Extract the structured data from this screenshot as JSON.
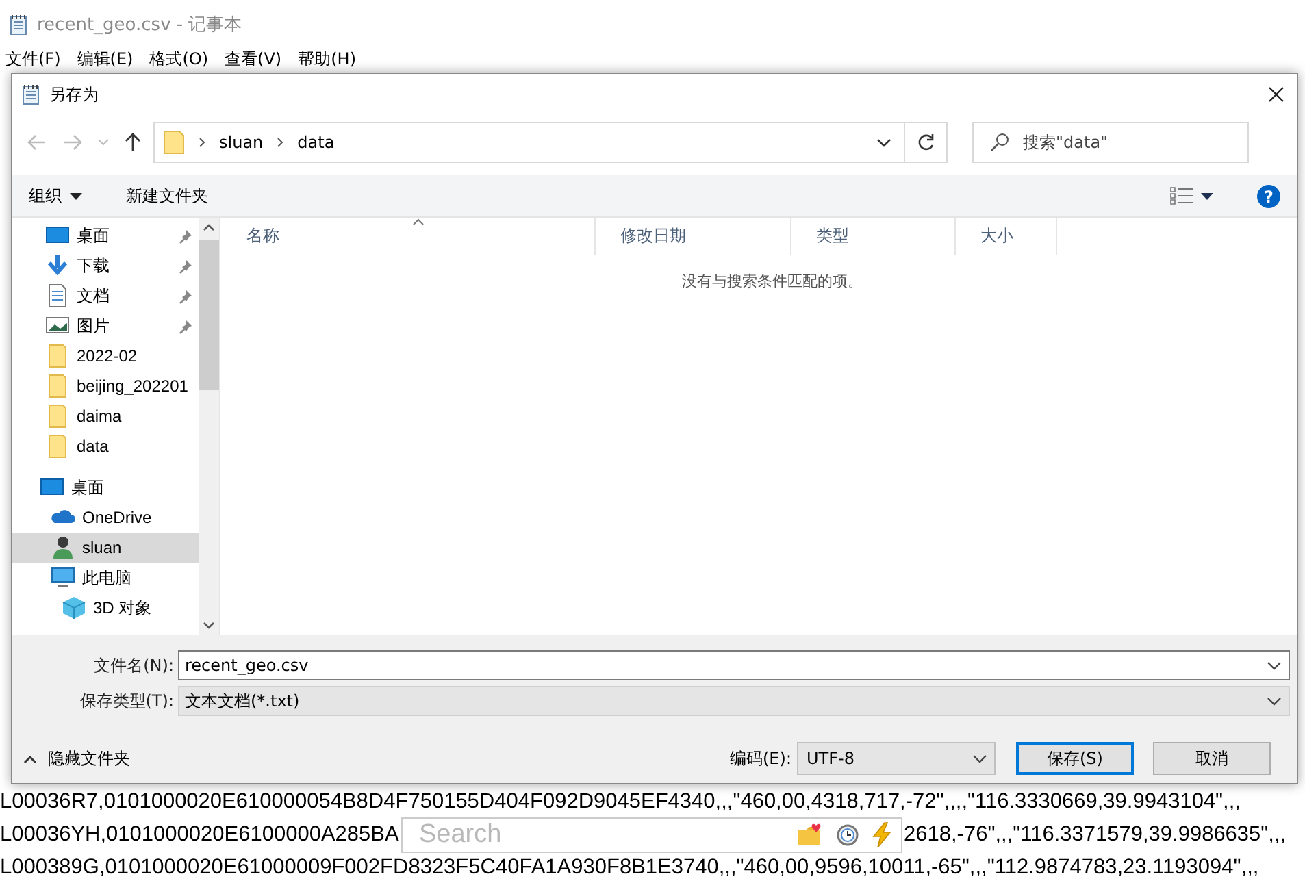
{
  "notepad": {
    "title": "recent_geo.csv - 记事本",
    "menu": [
      "文件(F)",
      "编辑(E)",
      "格式(O)",
      "查看(V)",
      "帮助(H)"
    ],
    "text_lines": [
      [
        "L00036R7,0101000020E610000054B8D4F750155D404F092D9045EF4340,,,\"460,00,4318,717,-72\",,,,\"116.3330669,39.9943104\",,,"
      ],
      [
        "L00036YH,0101000020E6100000A285BA",
        "2618,-76\",,,\"116.3371579,39.9986635\",,,"
      ],
      [
        "L000389G,0101000020E61000009F002FD8323F5C40FA1A930F8B1E3740,,,\"460,00,9596,10011,-65\",,,\"112.9874783,23.1193094\",,,"
      ]
    ]
  },
  "search_popup": {
    "placeholder": "Search"
  },
  "dialog": {
    "title": "另存为",
    "address": {
      "path": [
        "sluan",
        "data"
      ]
    },
    "search": {
      "placeholder": "搜索\"data\""
    },
    "toolbar": {
      "organize": "组织",
      "new_folder": "新建文件夹",
      "help": "?"
    },
    "navigation_pane": {
      "quick_access": [
        {
          "label": "桌面",
          "kind": "desktop",
          "pinned": true
        },
        {
          "label": "下载",
          "kind": "download",
          "pinned": true
        },
        {
          "label": "文档",
          "kind": "documents",
          "pinned": true
        },
        {
          "label": "图片",
          "kind": "pictures",
          "pinned": true
        },
        {
          "label": "2022-02",
          "kind": "folder",
          "pinned": false
        },
        {
          "label": "beijing_202201",
          "kind": "folder",
          "pinned": false
        },
        {
          "label": "daima",
          "kind": "folder",
          "pinned": false
        },
        {
          "label": "data",
          "kind": "folder",
          "pinned": false
        }
      ],
      "tree": [
        {
          "label": "桌面",
          "kind": "desktop",
          "selected": false,
          "children": [
            {
              "label": "OneDrive",
              "kind": "cloud",
              "selected": false
            },
            {
              "label": "sluan",
              "kind": "user",
              "selected": true
            },
            {
              "label": "此电脑",
              "kind": "pc",
              "selected": false,
              "children": [
                {
                  "label": "3D 对象",
                  "kind": "cube",
                  "selected": false
                }
              ]
            }
          ]
        }
      ]
    },
    "file_list": {
      "columns": [
        "名称",
        "修改日期",
        "类型",
        "大小"
      ],
      "empty_message": "没有与搜索条件匹配的项。"
    },
    "file_name": {
      "label": "文件名(N):",
      "value": "recent_geo.csv"
    },
    "save_type": {
      "label": "保存类型(T):",
      "value": "文本文档(*.txt)"
    },
    "hide_folders": "隐藏文件夹",
    "encoding": {
      "label": "编码(E):",
      "value": "UTF-8"
    },
    "buttons": [
      {
        "label": "保存(S)",
        "kind": "primary"
      },
      {
        "label": "取消",
        "kind": "normal"
      }
    ]
  }
}
